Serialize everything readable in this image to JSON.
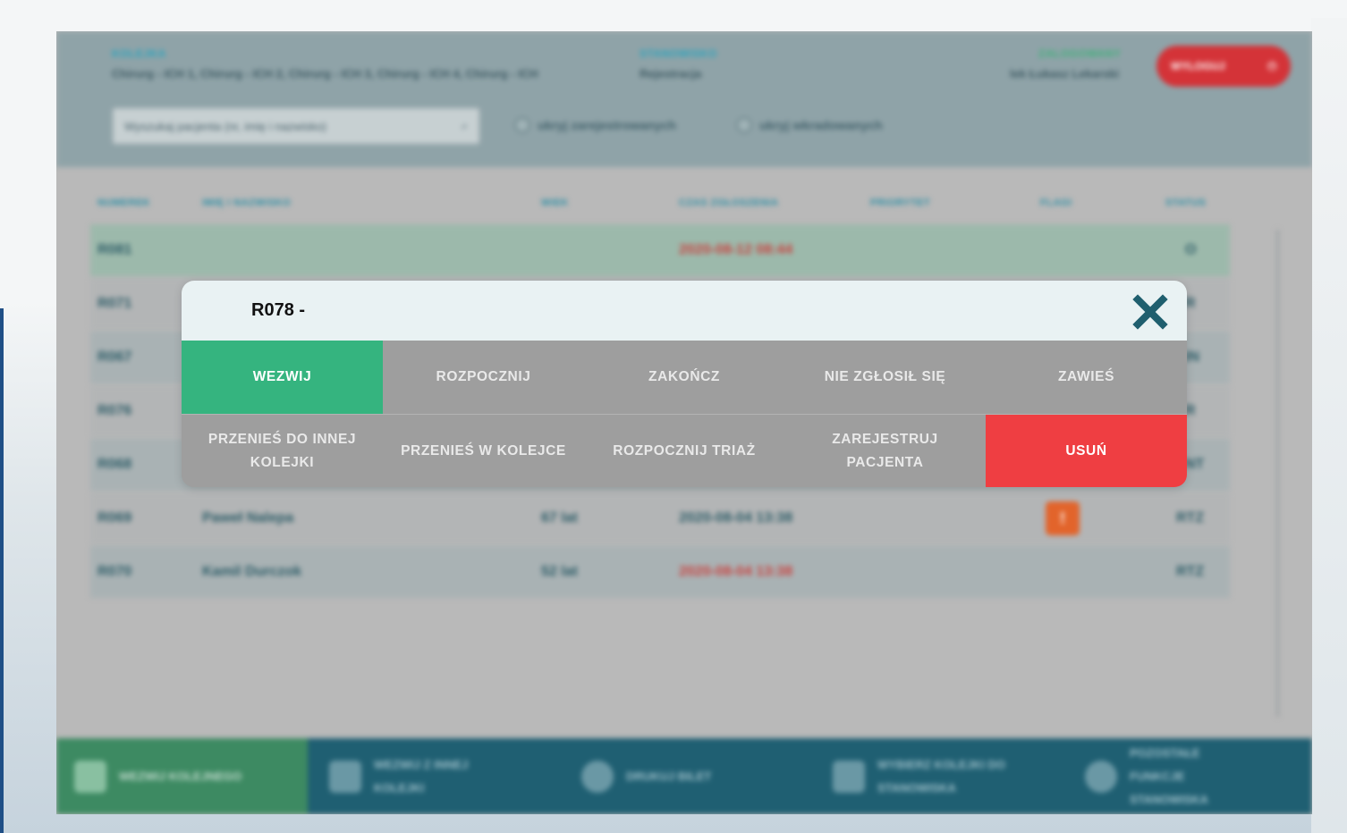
{
  "header": {
    "queue_label": "KOLEJKA",
    "queue_value": "Chirurg - ICH 1, Chirurg - ICH 2, Chirurg - ICH 3, Chirurg - ICH 4, Chirurg - ICH",
    "station_label": "STANOWISKO",
    "station_value": "Rejestracja",
    "logged_label": "ZALOGOWANY",
    "logged_value": "lek Łukasz Lekarski",
    "logout_label": "WYLOGUJ"
  },
  "search": {
    "placeholder": "Wyszukaj pacjenta (nr, imię i nazwisko)"
  },
  "filters": {
    "hide_registered": "ukryj zarejestrowanych",
    "hide_called": "ukryj wkradowanych"
  },
  "table": {
    "headers": {
      "number": "NUMEREK",
      "name": "IMIĘ I NAZWISKO",
      "age": "WIEK",
      "time": "CZAS ZGŁOSZENIA",
      "priority": "PRIORYTET",
      "flags": "FLAGI",
      "status": "STATUS"
    },
    "rows": [
      {
        "number": "R081",
        "name": "",
        "age": "",
        "time": "2020-08-12 08:44",
        "status": "O"
      },
      {
        "number": "R071",
        "name": "",
        "age": "",
        "time": "",
        "status": "R"
      },
      {
        "number": "R067",
        "name": "",
        "age": "",
        "time": "",
        "status": "IN"
      },
      {
        "number": "R076",
        "name": "",
        "age": "",
        "time": "",
        "status": "R"
      },
      {
        "number": "R068",
        "name": "",
        "age": "",
        "time": "",
        "status": "NT"
      },
      {
        "number": "R069",
        "name": "Paweł Nalepa",
        "age": "67 lat",
        "time": "2020-08-04 13:38",
        "flag": "!",
        "status": "RTZ"
      },
      {
        "number": "R070",
        "name": "Kamil Durczok",
        "age": "52 lat",
        "time": "2020-08-04 13:38",
        "status": "RTZ"
      }
    ]
  },
  "bottom_bar": {
    "call_next": "WEZWIJ KOLEJNEGO",
    "call_other_queue": "WEZWIJ Z INNEJ KOLEJKI",
    "print_ticket": "DRUKUJ BILET",
    "choose_queues": "WYBIERZ KOLEJKI DO STANOWISKA",
    "other_functions": "POZOSTAŁE FUNKCJE STANOWISKA"
  },
  "modal": {
    "title": "R078 -",
    "actions_row1": [
      "WEZWIJ",
      "ROZPOCZNIJ",
      "ZAKOŃCZ",
      "NIE ZGŁOSIŁ SIĘ",
      "ZAWIEŚ"
    ],
    "actions_row2": [
      "PRZENIEŚ DO INNEJ KOLEJKI",
      "PRZENIEŚ W KOLEJCE",
      "ROZPOCZNIJ TRIAŻ",
      "ZAREJESTRUJ PACJENTA",
      "USUŃ"
    ]
  },
  "colors": {
    "call": "#35b47f",
    "delete": "#ef3e42",
    "close_icon": "#1f5f6e",
    "header_bg": "#e9f2f3"
  }
}
